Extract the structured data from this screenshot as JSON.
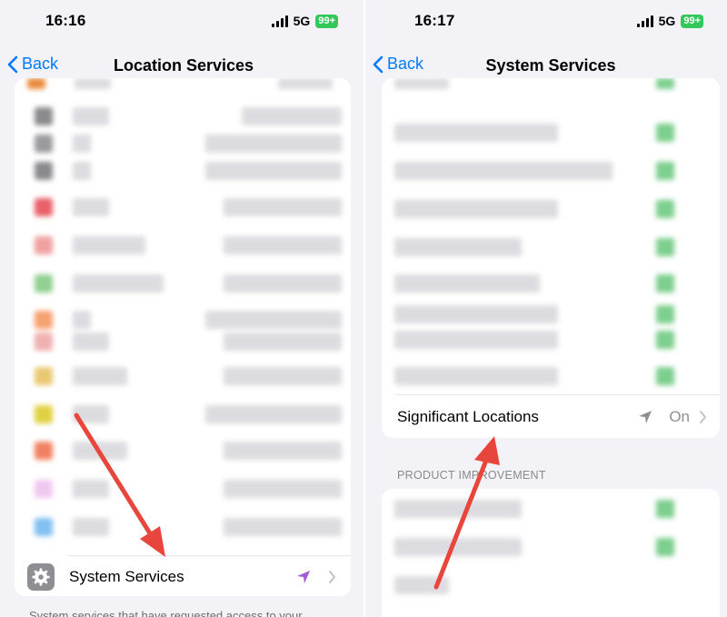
{
  "left_panel": {
    "status_bar": {
      "time": "16:16",
      "network": "5G",
      "battery": "99+"
    },
    "nav": {
      "back_label": "Back",
      "title": "Location Services"
    },
    "system_services_row": {
      "label": "System Services"
    },
    "footer_text": "System services that have requested access to your"
  },
  "right_panel": {
    "status_bar": {
      "time": "16:17",
      "network": "5G",
      "battery": "99+"
    },
    "nav": {
      "back_label": "Back",
      "title": "System Services"
    },
    "significant_locations_row": {
      "label": "Significant Locations",
      "value": "On"
    },
    "section_header": "PRODUCT IMPROVEMENT"
  },
  "colors": {
    "ios_blue": "#007aff",
    "toggle_green": "#34c759",
    "location_purple": "#a05bd5",
    "annotation_red": "#e8453c"
  },
  "icons": [
    "chevron-left-icon",
    "gear-icon",
    "location-arrow-icon",
    "chevron-right-icon",
    "cellular-signal-icon",
    "battery-icon"
  ]
}
